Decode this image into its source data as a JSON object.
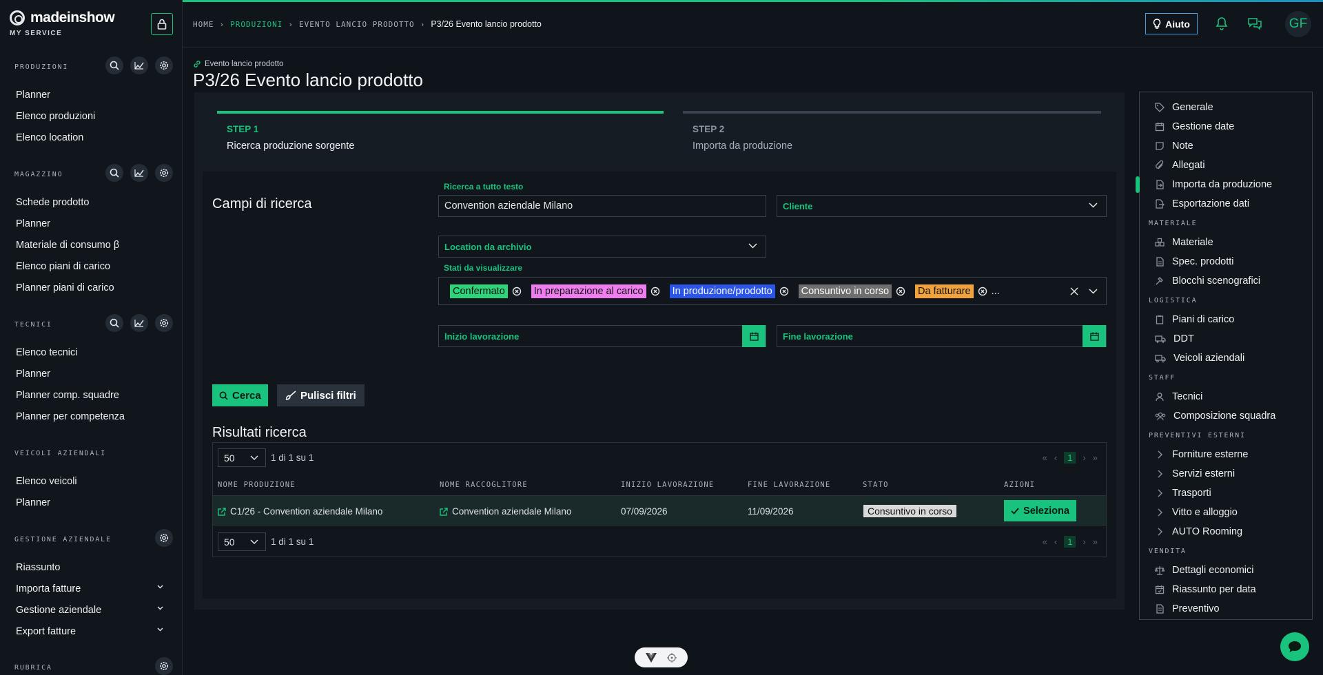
{
  "brand": {
    "name": "madeinshow",
    "sub": "MY SERVICE"
  },
  "sidebar": {
    "sections": [
      {
        "title": "PRODUZIONI",
        "items": [
          "Planner",
          "Elenco produzioni",
          "Elenco location"
        ]
      },
      {
        "title": "MAGAZZINO",
        "items": [
          "Schede prodotto",
          "Planner",
          "Materiale di consumo β",
          "Elenco piani di carico",
          "Planner piani di carico"
        ]
      },
      {
        "title": "TECNICI",
        "items": [
          "Elenco tecnici",
          "Planner",
          "Planner comp. squadre",
          "Planner per competenza"
        ]
      },
      {
        "title": "VEICOLI AZIENDALI",
        "items": [
          "Elenco veicoli",
          "Planner"
        ]
      },
      {
        "title": "GESTIONE AZIENDALE",
        "items": [
          "Riassunto",
          "Importa fatture",
          "Gestione aziendale",
          "Export fatture"
        ]
      },
      {
        "title": "RUBRICA",
        "items": []
      }
    ]
  },
  "breadcrumb": {
    "home": "HOME",
    "produzioni": "PRODUZIONI",
    "evento": "EVENTO LANCIO PRODOTTO",
    "current": "P3/26 Evento lancio prodotto"
  },
  "topbar": {
    "help": "Aiuto",
    "avatar": "GF"
  },
  "page": {
    "parent": "Evento lancio prodotto",
    "title": "P3/26 Evento lancio prodotto"
  },
  "steps": [
    {
      "label": "STEP 1",
      "desc": "Ricerca produzione sorgente"
    },
    {
      "label": "STEP 2",
      "desc": "Importa da produzione"
    }
  ],
  "form": {
    "title": "Campi di ricerca",
    "fulltext_label": "Ricerca a tutto testo",
    "fulltext_value": "Convention aziendale Milano",
    "cliente_placeholder": "Cliente",
    "location_placeholder": "Location da archivio",
    "stati_label": "Stati da visualizzare",
    "stati": [
      {
        "label": "Confermato",
        "color": "#2ed47a"
      },
      {
        "label": "In preparazione al carico",
        "color": "#f07df0"
      },
      {
        "label": "In produzione/prodotto",
        "color": "#2b54e8"
      },
      {
        "label": "Consuntivo in corso",
        "color": "#6e6e6e"
      },
      {
        "label": "Da fatturare",
        "color": "#f2a23a"
      }
    ],
    "stati_more": "...",
    "inizio_placeholder": "Inizio lavorazione",
    "fine_placeholder": "Fine lavorazione",
    "search_button": "Cerca",
    "clear_button": "Pulisci filtri"
  },
  "results": {
    "title": "Risultati ricerca",
    "page_size": "50",
    "summary": "1 di 1 su 1",
    "current_page": "1",
    "columns": [
      "NOME PRODUZIONE",
      "NOME RACCOGLITORE",
      "INIZIO LAVORAZIONE",
      "FINE LAVORAZIONE",
      "STATO",
      "AZIONI"
    ],
    "rows": [
      {
        "nome": "C1/26 - Convention aziendale Milano",
        "raccoglitore": "Convention aziendale Milano",
        "inizio": "07/09/2026",
        "fine": "11/09/2026",
        "stato": "Consuntivo in corso",
        "azione": "Seleziona"
      }
    ]
  },
  "right_menu": {
    "groups": [
      {
        "head": "",
        "items": [
          "Generale",
          "Gestione date",
          "Note",
          "Allegati",
          "Importa da produzione",
          "Esportazione dati"
        ]
      },
      {
        "head": "MATERIALE",
        "items": [
          "Materiale",
          "Spec. prodotti",
          "Blocchi scenografici"
        ]
      },
      {
        "head": "LOGISTICA",
        "items": [
          "Piani di carico",
          "DDT",
          "Veicoli aziendali"
        ]
      },
      {
        "head": "STAFF",
        "items": [
          "Tecnici",
          "Composizione squadra"
        ]
      },
      {
        "head": "PREVENTIVI ESTERNI",
        "items": [
          "Forniture esterne",
          "Servizi esterni",
          "Trasporti",
          "Vitto e alloggio",
          "AUTO Rooming"
        ]
      },
      {
        "head": "VENDITA",
        "items": [
          "Dettagli economici",
          "Riassunto per data",
          "Preventivo"
        ]
      }
    ],
    "active": "Importa da produzione"
  }
}
